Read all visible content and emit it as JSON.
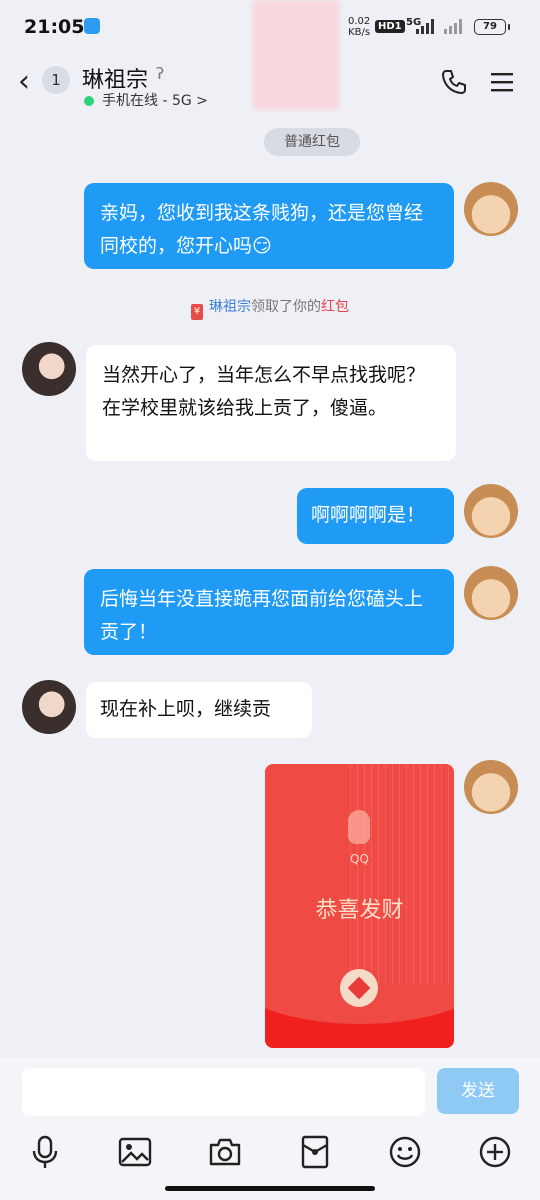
{
  "status": {
    "time": "21:05",
    "net_speed": "0.02",
    "net_unit": "KB/s",
    "hd": "HD1",
    "gen": "5G",
    "battery": "79"
  },
  "header": {
    "back_count": "1",
    "title": "琳祖宗",
    "presence": "手机在线 - 5G >"
  },
  "chat": {
    "top_pill": "普通红包",
    "msg1": "亲妈，您收到我这条贱狗，还是您曾经同校的，您开心吗😏",
    "notice_name": "琳祖宗",
    "notice_mid": "领取了你的",
    "notice_red": "红包",
    "msg2": "当然开心了，当年怎么不早点找我呢？在学校里就该给我上贡了，傻逼。",
    "msg3": "啊啊啊啊是！",
    "msg4": "后悔当年没直接跪再您面前给您磕头上贡了！",
    "msg5": "现在补上呗，继续贡",
    "redpacket_brand": "QQ",
    "redpacket_text": "恭喜发财"
  },
  "input": {
    "placeholder": "",
    "send_label": "发送"
  },
  "colors": {
    "outgoing": "#1f9bf5",
    "redpacket": "#f04a45",
    "send_disabled": "#8fcaf5"
  }
}
